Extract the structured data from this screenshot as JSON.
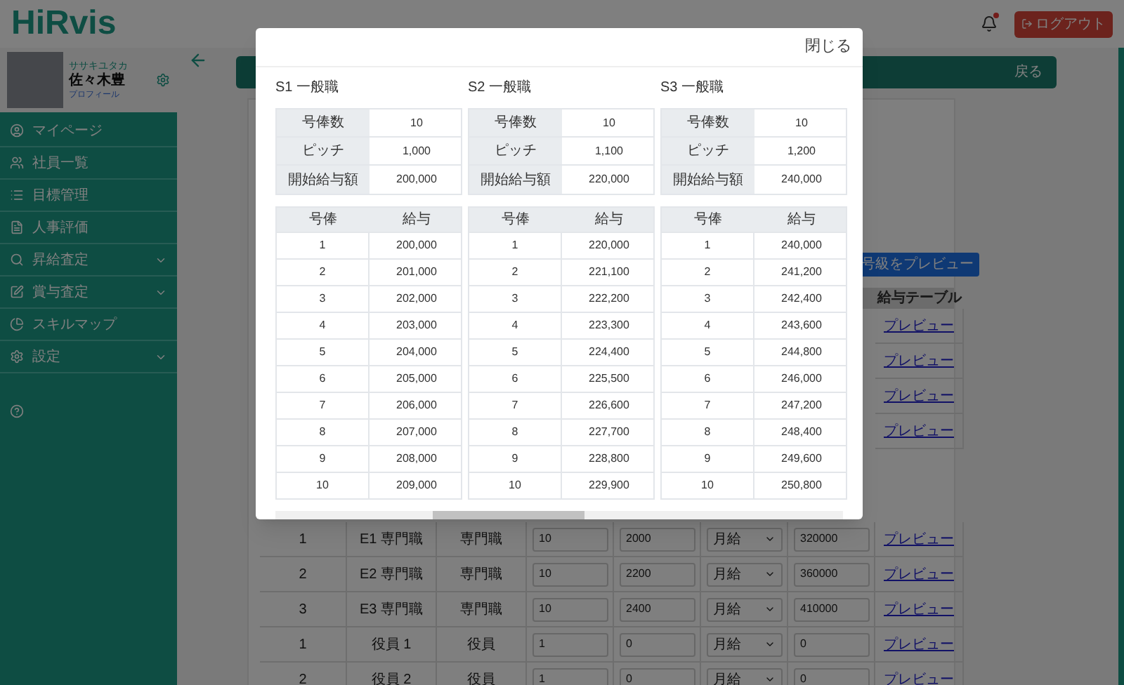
{
  "header": {
    "logo": "HiRvis",
    "notification_unread": true,
    "logout_button": "ログアウト"
  },
  "profile": {
    "kana": "ササキユタカ",
    "name": "佐々木豊",
    "link": "プロフィール"
  },
  "sidebar": {
    "items": [
      {
        "label": "マイページ",
        "kind": "link"
      },
      {
        "label": "社員一覧",
        "kind": "link"
      },
      {
        "label": "目標管理",
        "kind": "link"
      },
      {
        "label": "人事評価",
        "kind": "link"
      },
      {
        "label": "昇給査定",
        "kind": "group"
      },
      {
        "label": "賞与査定",
        "kind": "group"
      },
      {
        "label": "スキルマップ",
        "kind": "link"
      },
      {
        "label": "設定",
        "kind": "group"
      }
    ]
  },
  "page": {
    "back_link": "戻る",
    "preview_button": "号級をプレビュー",
    "table": {
      "columns": [
        "給与テーブル"
      ],
      "rows": [
        {
          "kind": "link_only",
          "link": "プレビュー"
        },
        {
          "kind": "link_only",
          "link": "プレビュー"
        },
        {
          "kind": "link_only",
          "link": "プレビュー"
        },
        {
          "kind": "link_only",
          "link": "プレビュー"
        },
        {
          "kind": "full",
          "number": "1",
          "name": "E1 専門職",
          "type": "専門職",
          "steps": "10",
          "pitch": "2000",
          "pay_type": "月給",
          "start": "320000",
          "link": "プレビュー"
        },
        {
          "kind": "full",
          "number": "2",
          "name": "E2 専門職",
          "type": "専門職",
          "steps": "10",
          "pitch": "2200",
          "pay_type": "月給",
          "start": "360000",
          "link": "プレビュー"
        },
        {
          "kind": "full",
          "number": "3",
          "name": "E3 専門職",
          "type": "専門職",
          "steps": "10",
          "pitch": "2400",
          "pay_type": "月給",
          "start": "410000",
          "link": "プレビュー"
        },
        {
          "kind": "full",
          "number": "1",
          "name": "役員 1",
          "type": "役員",
          "steps": "1",
          "pitch": "0",
          "pay_type": "月給",
          "start": "0",
          "link": "プレビュー"
        },
        {
          "kind": "full",
          "number": "2",
          "name": "役員 2",
          "type": "役員",
          "steps": "1",
          "pitch": "0",
          "pay_type": "月給",
          "start": "0",
          "link": "プレビュー"
        }
      ]
    }
  },
  "modal": {
    "close_button": "閉じる",
    "grades": [
      {
        "title": "S1 一般職",
        "info": [
          {
            "label": "号俸数",
            "value": "10"
          },
          {
            "label": "ピッチ",
            "value": "1,000"
          },
          {
            "label": "開始給与額",
            "value": "200,000"
          }
        ],
        "columns": [
          "号俸",
          "給与"
        ],
        "rows": [
          [
            "1",
            "200,000"
          ],
          [
            "2",
            "201,000"
          ],
          [
            "3",
            "202,000"
          ],
          [
            "4",
            "203,000"
          ],
          [
            "5",
            "204,000"
          ],
          [
            "6",
            "205,000"
          ],
          [
            "7",
            "206,000"
          ],
          [
            "8",
            "207,000"
          ],
          [
            "9",
            "208,000"
          ],
          [
            "10",
            "209,000"
          ]
        ]
      },
      {
        "title": "S2 一般職",
        "info": [
          {
            "label": "号俸数",
            "value": "10"
          },
          {
            "label": "ピッチ",
            "value": "1,100"
          },
          {
            "label": "開始給与額",
            "value": "220,000"
          }
        ],
        "columns": [
          "号俸",
          "給与"
        ],
        "rows": [
          [
            "1",
            "220,000"
          ],
          [
            "2",
            "221,100"
          ],
          [
            "3",
            "222,200"
          ],
          [
            "4",
            "223,300"
          ],
          [
            "5",
            "224,400"
          ],
          [
            "6",
            "225,500"
          ],
          [
            "7",
            "226,600"
          ],
          [
            "8",
            "227,700"
          ],
          [
            "9",
            "228,800"
          ],
          [
            "10",
            "229,900"
          ]
        ]
      },
      {
        "title": "S3 一般職",
        "info": [
          {
            "label": "号俸数",
            "value": "10"
          },
          {
            "label": "ピッチ",
            "value": "1,200"
          },
          {
            "label": "開始給与額",
            "value": "240,000"
          }
        ],
        "columns": [
          "号俸",
          "給与"
        ],
        "rows": [
          [
            "1",
            "240,000"
          ],
          [
            "2",
            "241,200"
          ],
          [
            "3",
            "242,400"
          ],
          [
            "4",
            "243,600"
          ],
          [
            "5",
            "244,800"
          ],
          [
            "6",
            "246,000"
          ],
          [
            "7",
            "247,200"
          ],
          [
            "8",
            "248,400"
          ],
          [
            "9",
            "249,600"
          ],
          [
            "10",
            "250,800"
          ]
        ]
      }
    ]
  }
}
